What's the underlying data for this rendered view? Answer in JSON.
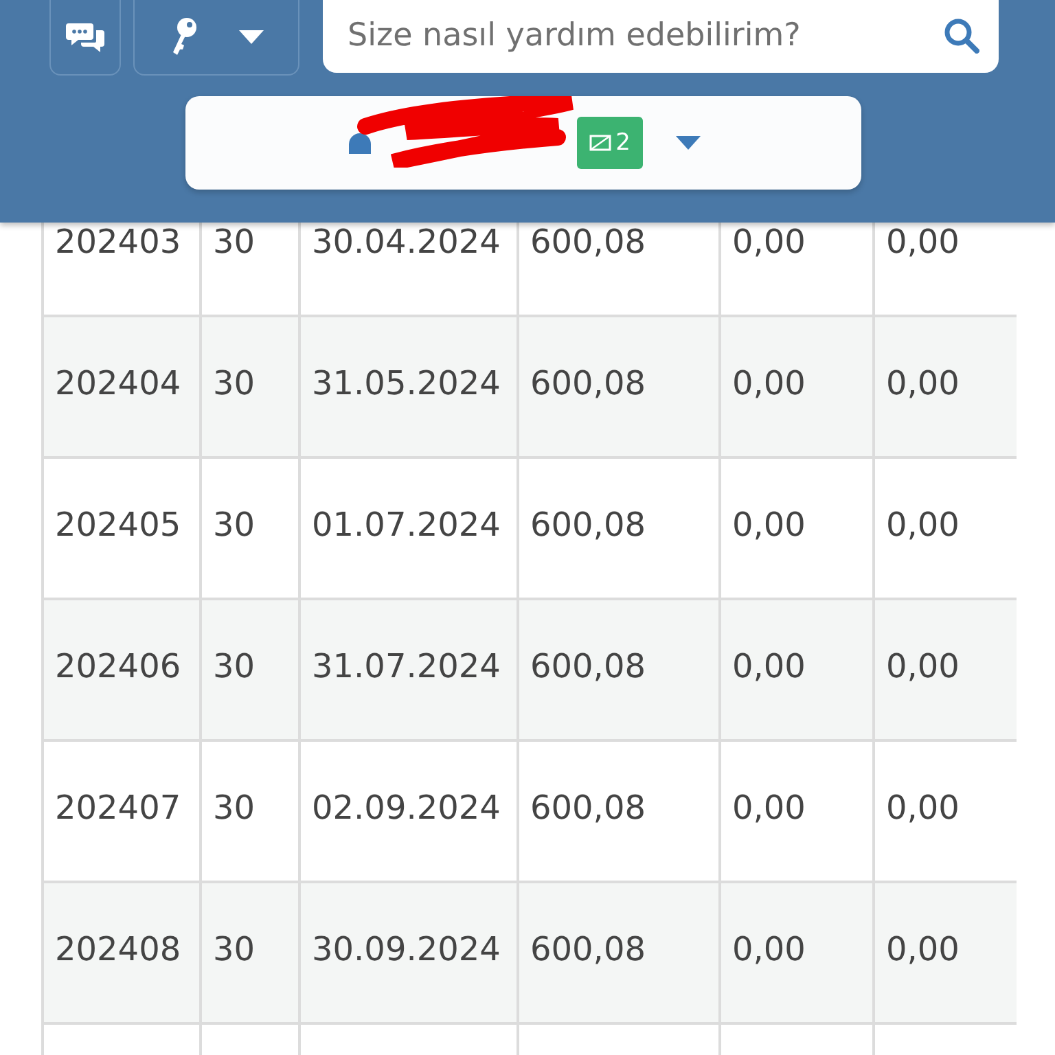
{
  "header": {
    "search": {
      "placeholder": "Size nasıl yardım edebilirim?"
    },
    "user_bar": {
      "message_count": "2"
    }
  },
  "table": {
    "rows": [
      {
        "cells": [
          "202403",
          "30",
          "30.04.2024",
          "600,08",
          "0,00",
          "0,00"
        ]
      },
      {
        "cells": [
          "202404",
          "30",
          "31.05.2024",
          "600,08",
          "0,00",
          "0,00"
        ]
      },
      {
        "cells": [
          "202405",
          "30",
          "01.07.2024",
          "600,08",
          "0,00",
          "0,00"
        ]
      },
      {
        "cells": [
          "202406",
          "30",
          "31.07.2024",
          "600,08",
          "0,00",
          "0,00"
        ]
      },
      {
        "cells": [
          "202407",
          "30",
          "02.09.2024",
          "600,08",
          "0,00",
          "0,00"
        ]
      },
      {
        "cells": [
          "202408",
          "30",
          "30.09.2024",
          "600,08",
          "0,00",
          "0,00"
        ]
      },
      {
        "cells": []
      }
    ]
  }
}
